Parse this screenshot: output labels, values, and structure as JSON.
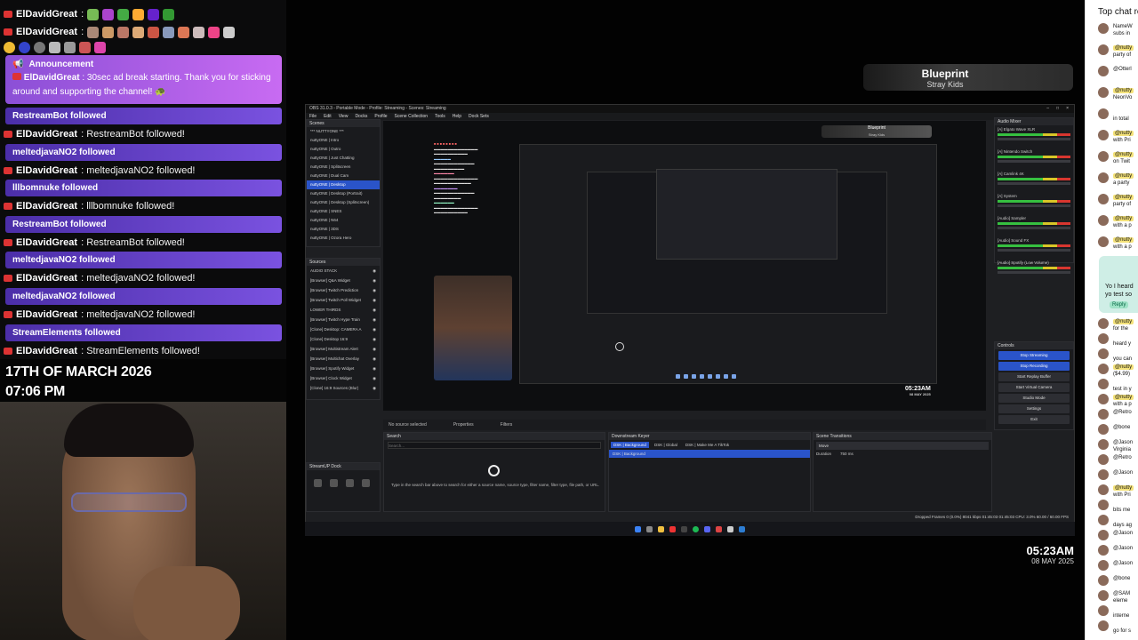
{
  "left_chat": {
    "lines": [
      {
        "name": "ElDavidGreat",
        "msg": ":"
      },
      {
        "name": "ElDavidGreat",
        "msg": ":"
      }
    ],
    "announcement": {
      "title": "Announcement",
      "name": "ElDavidGreat",
      "msg": ": 30sec ad break starting. Thank you for sticking around and supporting the channel! 🐢"
    },
    "follows": [
      {
        "banner": "RestreamBot followed",
        "name": "ElDavidGreat",
        "msg": ": RestreamBot followed!"
      },
      {
        "banner": "meltedjavaNO2 followed",
        "name": "ElDavidGreat",
        "msg": ": meltedjavaNO2 followed!"
      },
      {
        "banner": "lllbomnuke followed",
        "name": "ElDavidGreat",
        "msg": ": lllbomnuke followed!"
      },
      {
        "banner": "RestreamBot followed",
        "name": "ElDavidGreat",
        "msg": ": RestreamBot followed!"
      },
      {
        "banner": "meltedjavaNO2 followed",
        "name": "ElDavidGreat",
        "msg": ": meltedjavaNO2 followed!"
      },
      {
        "banner": "meltedjavaNO2 followed",
        "name": "ElDavidGreat",
        "msg": ": meltedjavaNO2 followed!"
      },
      {
        "banner": "StreamElements followed",
        "name": "ElDavidGreat",
        "msg": ": StreamElements followed!"
      }
    ]
  },
  "overlay": {
    "date": "17TH OF MARCH 2026",
    "time": "07:06 PM"
  },
  "now_playing": {
    "song": "Blueprint",
    "artist": "Stray Kids"
  },
  "clock": {
    "time": "05:23AM",
    "date": "08 MAY 2025"
  },
  "obs": {
    "title": "OBS 31.0.3 - Portable Mode - Profile: Streaming - Scenes: Streaming",
    "menu": [
      "File",
      "Edit",
      "View",
      "Docks",
      "Profile",
      "Scene Collection",
      "Tools",
      "Help",
      "Dock Sets"
    ],
    "scenes_header": "Scenes",
    "scenes": [
      "*** NUTTYONE ***",
      "nuttyONE | Intro",
      "nuttyONE | Outro",
      "nuttyONE | Just Chatting",
      "nuttyONE | Splitscreen",
      "nuttyONE | Dual Cam",
      "nuttyONE | Desktop",
      "nuttyONE | Desktop (Portrait)",
      "nuttyONE | Desktop (Splitscreen)",
      "nuttyONE | SNES",
      "nuttyONE | N64",
      "nuttyONE | 3DS",
      "nuttyONE | Ozora Hero"
    ],
    "selected_scene": "nuttyONE | Desktop",
    "sources_header": "Sources",
    "sources": [
      "AUDIO STACK",
      "[Browser] Q&A Widget",
      "[Browser] Twitch Prediction",
      "[Browser] Twitch Poll Widget",
      "LOWER THIRDS",
      "[Browser] Twitch Hype Train",
      "[Clone] Desktop: CAMERA A",
      "[Clone] Desktop 16:9",
      "[Browser] Multistream Alert",
      "[Browser] Multichat Overlay",
      "[Browser] Spotify Widget",
      "[Browser] Clock Widget",
      "[Clone] 16:9 Sources (Blur)"
    ],
    "streamup_header": "StreamUP Dock",
    "no_source": "No source selected",
    "properties_label": "Properties",
    "filters_label": "Filters",
    "search_header": "Search",
    "search_placeholder": "Search...",
    "search_hint": "Type in the search bar above to search for either a source name, source type, filter name, filter type, file path, or URL.",
    "dsk_header": "Downstream Keyer",
    "dsk_tabs": [
      "DSK | Background",
      "DSK | Global",
      "DSK | Make Me A TikTok"
    ],
    "dsk_items": [
      "DSK | Background"
    ],
    "transitions_header": "Scene Transitions",
    "transition_name": "Move",
    "duration_label": "Duration",
    "duration_value": "750 ms",
    "audio_header": "Audio Mixer",
    "audio_channels": [
      "[A] Elgato Wave XLR",
      "[A] Nintendo Switch",
      "[A] Camlink 4K",
      "[A] System",
      "[Audio] Sampler",
      "[Audio] Sound FX",
      "[Audio] Spotify (Low Volume)"
    ],
    "controls_header": "Controls",
    "controls": [
      "Stop Streaming",
      "Stop Recording",
      "Start Replay Buffer",
      "Start Virtual Camera",
      "Studio Mode",
      "Settings",
      "Exit"
    ],
    "status": "Dropped Frames 0 (0.0%)    8041 kbps    01:45:03    01:45:03    CPU: 3.0%    60.00 / 60.00 FPS",
    "win_controls": [
      "–",
      "□",
      "×"
    ]
  },
  "right_chat": {
    "header": "Top chat replay",
    "rows": [
      {
        "user": "NameW",
        "text": "subs in",
        "hl": false
      },
      {
        "user": "@nutty",
        "text": "party of",
        "hl": true
      },
      {
        "user": "@Otterl",
        "text": "",
        "hl": false
      },
      {
        "user": "@nutty",
        "text": "NeonVo",
        "hl": true
      },
      {
        "user": "",
        "text": "in total",
        "hl": false
      },
      {
        "user": "@nutty",
        "text": "with Pri",
        "hl": true
      },
      {
        "user": "@nutty",
        "text": "on Twit",
        "hl": true
      },
      {
        "user": "@nutty",
        "text": "a party",
        "hl": true
      },
      {
        "user": "@nutty",
        "text": "party of",
        "hl": true
      },
      {
        "user": "@nutty",
        "text": "with a p",
        "hl": true
      },
      {
        "user": "@nutty",
        "text": "with a p",
        "hl": true
      }
    ],
    "reply_text": "Yo I heard yo test so",
    "reply_label": "Reply",
    "rows2": [
      {
        "user": "@nutty",
        "text": "for the",
        "hl": true
      },
      {
        "user": "",
        "text": "heard y",
        "hl": false
      },
      {
        "user": "",
        "text": "you can",
        "hl": false
      },
      {
        "user": "@nutty",
        "text": "($4.99)",
        "hl": true
      },
      {
        "user": "",
        "text": "test in y",
        "hl": false
      },
      {
        "user": "@nutty",
        "text": "with a p",
        "hl": true
      },
      {
        "user": "@Retro",
        "text": "",
        "hl": false
      },
      {
        "user": "@bone",
        "text": "",
        "hl": false
      },
      {
        "user": "@Jason",
        "text": "Virginia",
        "hl": false
      },
      {
        "user": "@Retro",
        "text": "",
        "hl": false
      },
      {
        "user": "@Jason",
        "text": "",
        "hl": false
      },
      {
        "user": "@nutty",
        "text": "with Pri",
        "hl": true
      },
      {
        "user": "",
        "text": "bits me",
        "hl": false
      },
      {
        "user": "",
        "text": "days ag",
        "hl": false
      },
      {
        "user": "@Jason",
        "text": "",
        "hl": false
      },
      {
        "user": "@Jason",
        "text": "",
        "hl": false
      },
      {
        "user": "@Jason",
        "text": "",
        "hl": false
      },
      {
        "user": "@bone",
        "text": "",
        "hl": false
      },
      {
        "user": "@SAM",
        "text": "eleme",
        "hl": false
      },
      {
        "user": "",
        "text": "interne",
        "hl": false
      },
      {
        "user": "",
        "text": "go for s",
        "hl": false
      }
    ]
  },
  "colors": {
    "announce_start": "#8b4fd6",
    "announce_end": "#c86bf2",
    "follow_start": "#4b2ea8",
    "follow_end": "#7a52e0",
    "obs_selected": "#2a54c9",
    "highlight": "#f4e27a"
  }
}
